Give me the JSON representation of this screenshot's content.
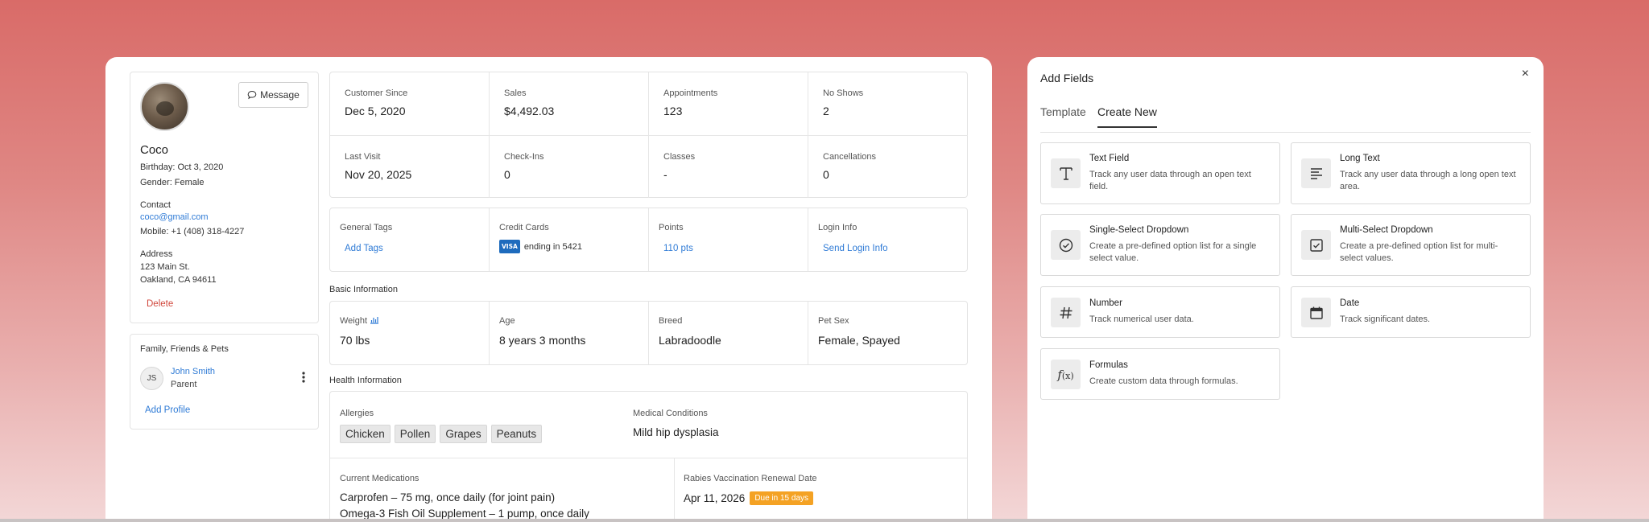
{
  "profile": {
    "message_label": "Message",
    "name": "Coco",
    "birthday": "Birthday: Oct 3, 2020",
    "gender": "Gender: Female",
    "contact_heading": "Contact",
    "email": "coco@gmail.com",
    "mobile": "Mobile: +1 (408) 318-4227",
    "address_heading": "Address",
    "address_line1": "123 Main St.",
    "address_line2": "Oakland, CA 94611",
    "delete_label": "Delete"
  },
  "family": {
    "title": "Family, Friends & Pets",
    "member": {
      "initials": "JS",
      "name": "John Smith",
      "relation": "Parent"
    },
    "add_profile_label": "Add Profile"
  },
  "stats": [
    {
      "label": "Customer Since",
      "value": "Dec 5, 2020"
    },
    {
      "label": "Sales",
      "value": "$4,492.03"
    },
    {
      "label": "Appointments",
      "value": "123"
    },
    {
      "label": "No Shows",
      "value": "2"
    },
    {
      "label": "Last Visit",
      "value": "Nov 20, 2025"
    },
    {
      "label": "Check-Ins",
      "value": "0"
    },
    {
      "label": "Classes",
      "value": "-"
    },
    {
      "label": "Cancellations",
      "value": "0"
    }
  ],
  "info": {
    "general_tags_label": "General Tags",
    "add_tags_label": "Add Tags",
    "credit_cards_label": "Credit Cards",
    "visa_label": "VISA",
    "card_text": "ending in 5421",
    "points_label": "Points",
    "points_value": "110 pts",
    "login_label": "Login Info",
    "login_action": "Send Login Info"
  },
  "basic": {
    "title": "Basic Information",
    "fields": [
      {
        "label": "Weight",
        "value": "70 lbs"
      },
      {
        "label": "Age",
        "value": "8 years 3 months"
      },
      {
        "label": "Breed",
        "value": "Labradoodle"
      },
      {
        "label": "Pet Sex",
        "value": "Female, Spayed"
      }
    ]
  },
  "health": {
    "title": "Health Information",
    "allergies_label": "Allergies",
    "allergies": [
      "Chicken",
      "Pollen",
      "Grapes",
      "Peanuts"
    ],
    "conditions_label": "Medical Conditions",
    "conditions_value": "Mild hip dysplasia",
    "meds_label": "Current Medications",
    "med1": "Carprofen – 75 mg, once daily (for joint pain)",
    "med2": "Omega-3 Fish Oil Supplement – 1 pump, once daily",
    "rabies_label": "Rabies Vaccination Renewal Date",
    "rabies_date": "Apr 11, 2026",
    "rabies_badge": "Due in 15 days"
  },
  "add_fields": {
    "title": "Add Fields",
    "close_icon": "×",
    "tabs": [
      {
        "label": "Template",
        "active": false
      },
      {
        "label": "Create New",
        "active": true
      }
    ],
    "fields": [
      {
        "name": "Text Field",
        "desc": "Track any user data through an open text field.",
        "icon": "text-field-icon"
      },
      {
        "name": "Long Text",
        "desc": "Track any user data through a long open text area.",
        "icon": "long-text-icon"
      },
      {
        "name": "Single-Select Dropdown",
        "desc": "Create a pre-defined option list for a single select value.",
        "icon": "single-select-icon"
      },
      {
        "name": "Multi-Select Dropdown",
        "desc": "Create a pre-defined option list for multi-select values.",
        "icon": "multi-select-icon"
      },
      {
        "name": "Number",
        "desc": "Track numerical user data.",
        "icon": "number-icon"
      },
      {
        "name": "Date",
        "desc": "Track significant dates.",
        "icon": "calendar-icon"
      },
      {
        "name": "Formulas",
        "desc": "Create custom data through formulas.",
        "icon": "formula-icon"
      }
    ]
  },
  "colors": {
    "link": "#2f7bd6",
    "delete": "#d0463b",
    "badge": "#f4a224",
    "visa": "#1e6bbd"
  }
}
